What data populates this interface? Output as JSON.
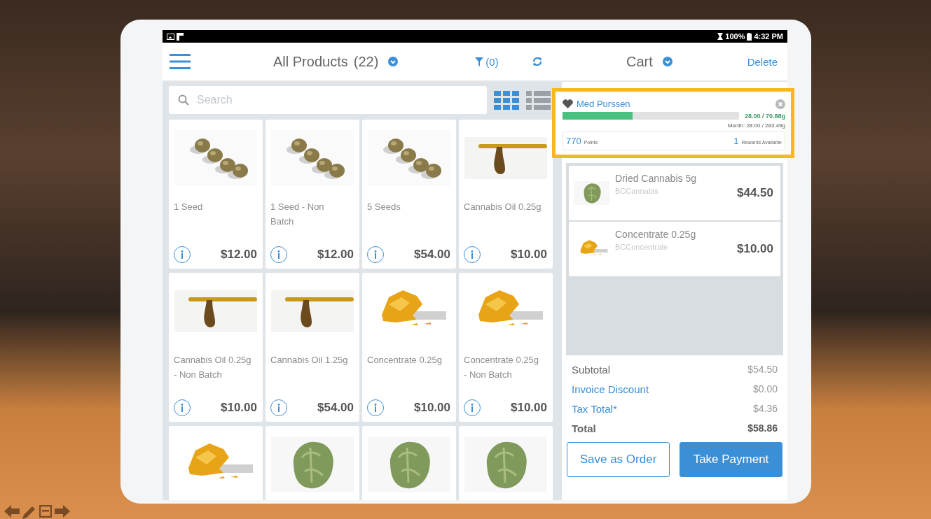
{
  "status_bar": {
    "battery": "100%",
    "time": "4:32 PM"
  },
  "header": {
    "title": "All Products",
    "count": "(22)",
    "filter": "(0)",
    "cart_title": "Cart",
    "delete": "Delete"
  },
  "search": {
    "placeholder": "Search"
  },
  "view_modes": [
    {
      "kind": "grid",
      "selected": true
    },
    {
      "kind": "list",
      "selected": false
    }
  ],
  "products": [
    {
      "name": "1 Seed",
      "price": "$12.00",
      "kind": "seeds"
    },
    {
      "name": "1 Seed - Non Batch",
      "price": "$12.00",
      "kind": "seeds"
    },
    {
      "name": "5 Seeds",
      "price": "$54.00",
      "kind": "seeds"
    },
    {
      "name": "Cannabis Oil 0.25g",
      "price": "$10.00",
      "kind": "oil"
    },
    {
      "name": "Cannabis Oil 0.25g - Non Batch",
      "price": "$10.00",
      "kind": "oil"
    },
    {
      "name": "Cannabis Oil 1.25g",
      "price": "$54.00",
      "kind": "oil"
    },
    {
      "name": "Concentrate 0.25g",
      "price": "$10.00",
      "kind": "concentrate"
    },
    {
      "name": "Concentrate 0.25g - Non Batch",
      "price": "$10.00",
      "kind": "concentrate"
    },
    {
      "kind": "concentrate"
    },
    {
      "kind": "flower"
    },
    {
      "kind": "flower"
    },
    {
      "kind": "flower"
    }
  ],
  "customer": {
    "name": "Med Purssen",
    "highlighted": true,
    "level": 0.395,
    "limit": "28.00 / 70.88g",
    "month": "Month: 28.00 / 283.49g",
    "points": "770",
    "points_label": "Points",
    "rewards": "1",
    "rewards_label": "Rewards Available"
  },
  "cart_items": [
    {
      "name": "Dried Cannabis 5g",
      "category": "BCCannabis",
      "price": "$44.50",
      "kind": "flower"
    },
    {
      "name": "Concentrate 0.25g",
      "category": "BCConcentrate",
      "price": "$10.00",
      "kind": "concentrate"
    }
  ],
  "totals": [
    {
      "label": "Subtotal",
      "value": "$54.50",
      "kind": "plain"
    },
    {
      "label": "Invoice Discount",
      "value": "$0.00",
      "kind": "link"
    },
    {
      "label": "Tax Total*",
      "value": "$4.36",
      "kind": "link"
    },
    {
      "label": "Total",
      "value": "$58.86",
      "kind": "total"
    }
  ],
  "buttons": [
    {
      "label": "Save as Order",
      "kind": "outline"
    },
    {
      "label": "Take Payment",
      "kind": "primary"
    }
  ]
}
